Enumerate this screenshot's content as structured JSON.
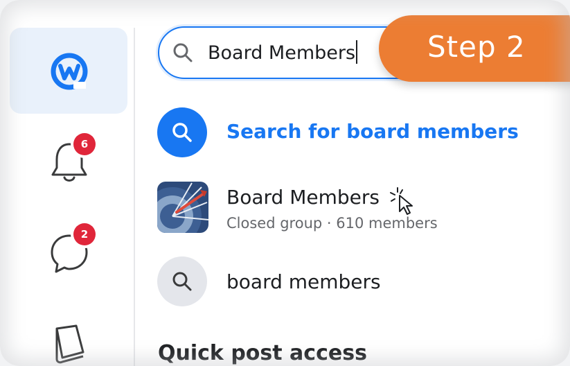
{
  "search": {
    "value": "Board Members"
  },
  "step_label": "Step 2",
  "sidebar": {
    "notifications_badge": "6",
    "messages_badge": "2"
  },
  "results": [
    {
      "type": "search",
      "label": "Search for board members"
    },
    {
      "type": "group",
      "title": "Board Members",
      "subtitle": "Closed group · 610 members"
    },
    {
      "type": "suggestion",
      "label": "board members"
    }
  ],
  "section": {
    "title": "Quick post access"
  },
  "colors": {
    "accent": "#1877f2",
    "step_orange": "#ec7d33",
    "badge_red": "#e0263a"
  }
}
